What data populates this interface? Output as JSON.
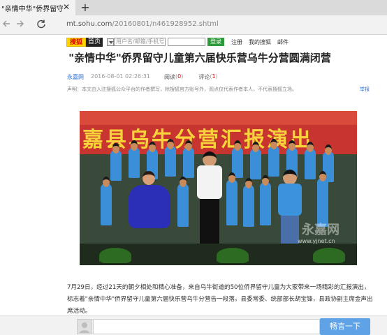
{
  "browser": {
    "tab_title": "\"亲情中华\"侨界留守儿童",
    "tab_close": "✕",
    "new_tab": "+",
    "url_host": "mt.sohu.com",
    "url_path": "/20160801/n461928952.shtml",
    "icons": {
      "back": "arrow-left",
      "forward": "arrow-right",
      "refresh": "refresh"
    }
  },
  "sohu_toolbar": {
    "logo": "搜狐",
    "home": "首页",
    "username_placeholder": "用户名/邮箱/手机号",
    "login": "登录",
    "links": [
      "注册",
      "我的搜狐",
      "邮件"
    ],
    "colors": {
      "logo_bg": "#ffd400",
      "login_bg": "#2f9a3a"
    }
  },
  "article": {
    "title": "\"亲情中华\"侨界留守儿童第六届快乐营乌牛分营圆满闭营",
    "source": "永嘉网",
    "date": "2016-08-01 02:26:31",
    "read_label": "阅读",
    "read_prefix": "(",
    "read_count": "0",
    "read_suffix": ")",
    "comment_label": "评论",
    "comment_prefix": "(",
    "comment_count": "1",
    "comment_suffix": ")",
    "notice": "声明：本文由入驻搜狐公众平台的作者撰写，除搜狐官方账号外，观点仅代表作者本人，不代表搜狐立场。",
    "report": "举报",
    "photo": {
      "banner_text": "嘉县乌牛分营汇报演出",
      "watermark": "永嘉网",
      "watermark_url": "www.yjnet.cn"
    },
    "paragraph": "7月29日，经过21天的朝夕相处和精心准备，来自乌牛街道的50位侨界留守儿童为大家带来一场精彩的汇报演出，标志着\"亲情中华\"侨界留守儿童第六届快乐营乌牛分营告一段落。县委常委、统部部长胡宝锋，县政协副主席金声出席活动。"
  },
  "comment_bar": {
    "button": "畅言一下",
    "colors": {
      "button_bg": "#5fa3e6"
    }
  }
}
